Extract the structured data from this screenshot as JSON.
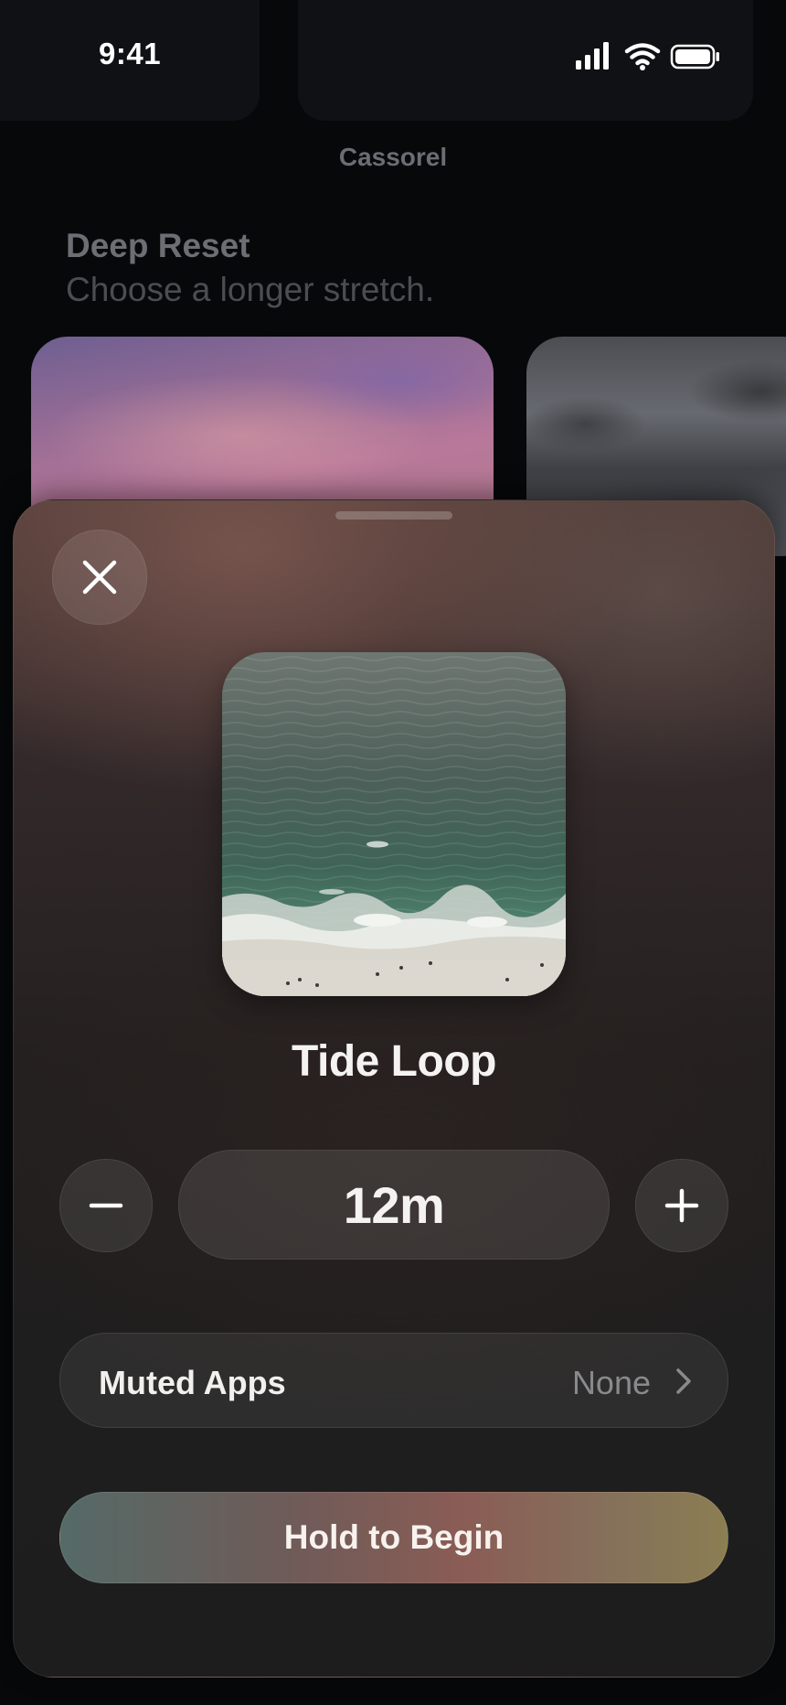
{
  "status_bar": {
    "time": "9:41",
    "icons": [
      "signal-icon",
      "wifi-icon",
      "battery-icon"
    ]
  },
  "app": {
    "name": "Cassorel"
  },
  "section": {
    "title": "Deep Reset",
    "subtitle": "Choose a longer stretch."
  },
  "background_cards": [
    {
      "image": "sunset-sky"
    },
    {
      "image": "coastal-rocks"
    }
  ],
  "sheet": {
    "close_icon": "close-icon",
    "artwork": "aerial-ocean-beach",
    "title": "Tide Loop",
    "duration": {
      "value": "12m",
      "decrement_icon": "minus-icon",
      "increment_icon": "plus-icon"
    },
    "muted_apps": {
      "label": "Muted Apps",
      "value": "None"
    },
    "cta": {
      "label": "Hold to Begin"
    }
  },
  "colors": {
    "background": "#07080a",
    "sheet_top": "#4e3a36",
    "sheet_bottom": "#1d1d1d",
    "cta_start": "#556a67",
    "cta_mid": "#8a5c55",
    "cta_end": "#8b7e52"
  }
}
